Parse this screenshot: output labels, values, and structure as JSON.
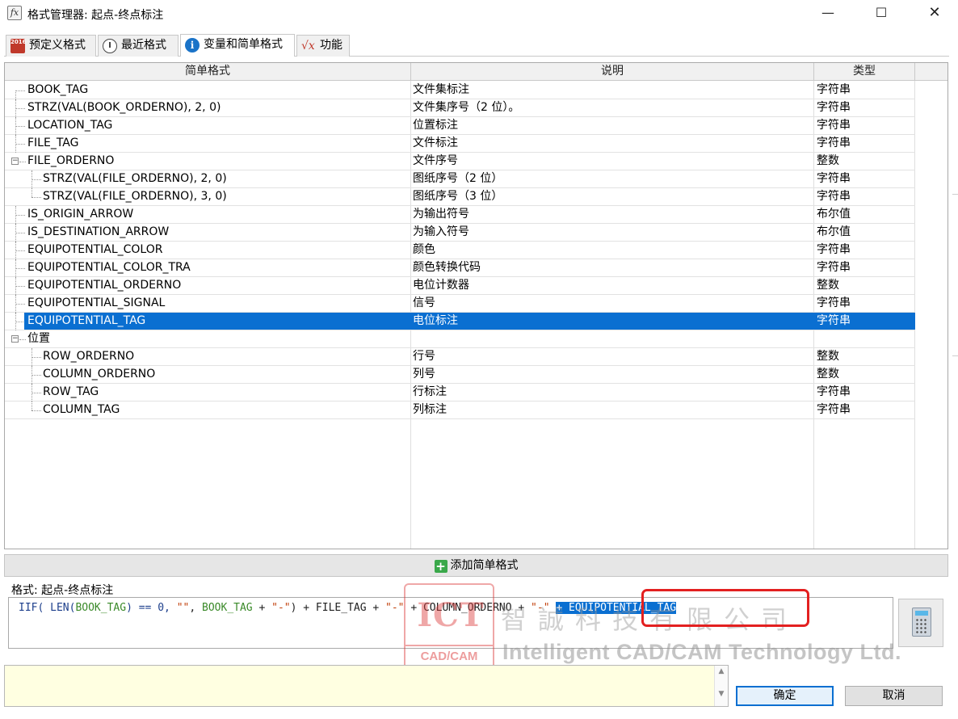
{
  "window": {
    "icon_label": "fx",
    "title": "格式管理器: 起点-终点标注",
    "minimize": "—",
    "maximize": "☐",
    "close": "✕"
  },
  "tabs": [
    {
      "label": "预定义格式",
      "icon": "book-2016-icon"
    },
    {
      "label": "最近格式",
      "icon": "clock-icon"
    },
    {
      "label": "变量和简单格式",
      "icon": "info-icon",
      "active": true
    },
    {
      "label": "功能",
      "icon": "sqrt-x-icon"
    }
  ],
  "grid": {
    "columns": [
      "简单格式",
      "说明",
      "类型"
    ],
    "rows": [
      {
        "name": "BOOK_TAG",
        "desc": "文件集标注",
        "type": "字符串",
        "level": 0
      },
      {
        "name": "STRZ(VAL(BOOK_ORDERNO), 2, 0)",
        "desc": "文件集序号（2 位）。",
        "type": "字符串",
        "level": 0
      },
      {
        "name": "LOCATION_TAG",
        "desc": "位置标注",
        "type": "字符串",
        "level": 0
      },
      {
        "name": "FILE_TAG",
        "desc": "文件标注",
        "type": "字符串",
        "level": 0
      },
      {
        "name": "FILE_ORDERNO",
        "desc": "文件序号",
        "type": "整数",
        "level": 0,
        "expander": "−"
      },
      {
        "name": "STRZ(VAL(FILE_ORDERNO), 2, 0)",
        "desc": "图纸序号（2 位）",
        "type": "字符串",
        "level": 1
      },
      {
        "name": "STRZ(VAL(FILE_ORDERNO), 3, 0)",
        "desc": "图纸序号（3 位）",
        "type": "字符串",
        "level": 1
      },
      {
        "name": "IS_ORIGIN_ARROW",
        "desc": "为输出符号",
        "type": "布尔值",
        "level": 0
      },
      {
        "name": "IS_DESTINATION_ARROW",
        "desc": "为输入符号",
        "type": "布尔值",
        "level": 0
      },
      {
        "name": "EQUIPOTENTIAL_COLOR",
        "desc": "颜色",
        "type": "字符串",
        "level": 0
      },
      {
        "name": "EQUIPOTENTIAL_COLOR_TRA",
        "desc": "颜色转换代码",
        "type": "字符串",
        "level": 0
      },
      {
        "name": "EQUIPOTENTIAL_ORDERNO",
        "desc": "电位计数器",
        "type": "整数",
        "level": 0
      },
      {
        "name": "EQUIPOTENTIAL_SIGNAL",
        "desc": "信号",
        "type": "字符串",
        "level": 0
      },
      {
        "name": "EQUIPOTENTIAL_TAG",
        "desc": "电位标注",
        "type": "字符串",
        "level": 0,
        "selected": true
      },
      {
        "name": "位置",
        "desc": "",
        "type": "",
        "level": 0,
        "expander": "−"
      },
      {
        "name": "ROW_ORDERNO",
        "desc": "行号",
        "type": "整数",
        "level": 1
      },
      {
        "name": "COLUMN_ORDERNO",
        "desc": "列号",
        "type": "整数",
        "level": 1
      },
      {
        "name": "ROW_TAG",
        "desc": "行标注",
        "type": "字符串",
        "level": 1
      },
      {
        "name": "COLUMN_TAG",
        "desc": "列标注",
        "type": "字符串",
        "level": 1
      }
    ]
  },
  "add_button": {
    "label": "添加简单格式",
    "icon": "plus-icon"
  },
  "format": {
    "label": "格式: 起点-终点标注",
    "tokens": [
      {
        "t": "IIF( ",
        "k": "fn"
      },
      {
        "t": "LEN(",
        "k": "fn"
      },
      {
        "t": "BOOK_TAG",
        "k": "var"
      },
      {
        "t": ") == 0, ",
        "k": "fn"
      },
      {
        "t": "\"\"",
        "k": "str"
      },
      {
        "t": ", ",
        "k": "op"
      },
      {
        "t": "BOOK_TAG",
        "k": "var"
      },
      {
        "t": " + ",
        "k": "op"
      },
      {
        "t": "\"-\"",
        "k": "str"
      },
      {
        "t": ") + FILE_TAG + ",
        "k": "op"
      },
      {
        "t": "\"-\"",
        "k": "str"
      },
      {
        "t": " + COLUMN_ORDERNO  + ",
        "k": "op"
      },
      {
        "t": "\"-\"",
        "k": "str"
      },
      {
        "t": " ",
        "k": "op"
      },
      {
        "t": "+ EQUIPOTENTIAL_TAG ",
        "k": "hl"
      }
    ]
  },
  "calculator_icon": "calculator-icon",
  "message_box": {
    "text": ""
  },
  "buttons": {
    "ok": "确定",
    "cancel": "取消"
  },
  "watermark": {
    "logo_top": "ICT",
    "logo_bottom": "CAD/CAM",
    "cn": "智誠科技有限公司",
    "en": "Intelligent CAD/CAM Technology Ltd."
  },
  "colors": {
    "selection": "#0a6fd1",
    "message_bg": "#ffffe1",
    "highlight_box": "#e32020"
  }
}
